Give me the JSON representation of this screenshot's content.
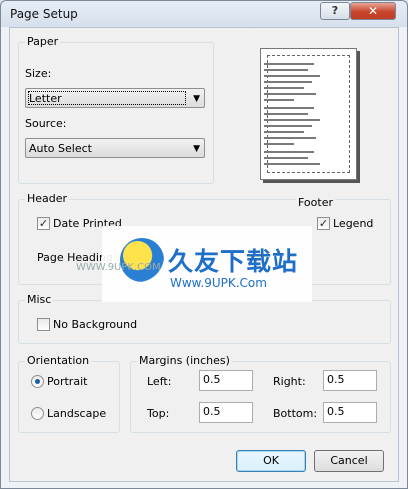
{
  "window": {
    "title": "Page Setup",
    "help_glyph": "?",
    "close_glyph": "✕"
  },
  "paper": {
    "group_label": "Paper",
    "size_label": "Size:",
    "size_value": "Letter",
    "source_label": "Source:",
    "source_value": "Auto Select"
  },
  "header": {
    "group_label": "Header",
    "date_printed_label": "Date Printed",
    "date_printed_checked": true,
    "page_heading_label": "Page Heading"
  },
  "footer": {
    "group_label": "Footer",
    "legend_label": "Legend",
    "legend_checked": true
  },
  "misc": {
    "group_label": "Misc",
    "no_background_label": "No Background",
    "no_background_checked": false
  },
  "orientation": {
    "group_label": "Orientation",
    "portrait_label": "Portrait",
    "landscape_label": "Landscape",
    "selected": "Portrait"
  },
  "margins": {
    "group_label": "Margins (inches)",
    "left_label": "Left:",
    "left_value": "0.5",
    "right_label": "Right:",
    "right_value": "0.5",
    "top_label": "Top:",
    "top_value": "0.5",
    "bottom_label": "Bottom:",
    "bottom_value": "0.5"
  },
  "buttons": {
    "ok": "OK",
    "cancel": "Cancel"
  },
  "watermark": {
    "text": "久友下载站",
    "url": "Www.9UPK.Com",
    "url2": "WWW.9UPK.COM"
  }
}
